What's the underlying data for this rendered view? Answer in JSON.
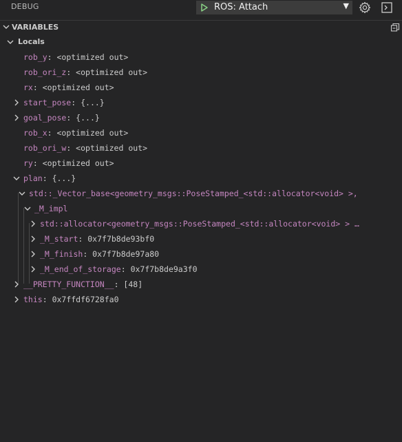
{
  "header": {
    "title": "DEBUG",
    "launch_config": "ROS: Attach"
  },
  "section": {
    "title": "VARIABLES"
  },
  "scope": {
    "label": "Locals"
  },
  "variables": [
    {
      "name": "rob_y",
      "value": "<optimized out>"
    },
    {
      "name": "rob_ori_z",
      "value": "<optimized out>"
    },
    {
      "name": "rx",
      "value": "<optimized out>"
    },
    {
      "name": "start_pose",
      "value": "{...}"
    },
    {
      "name": "goal_pose",
      "value": "{...}"
    },
    {
      "name": "rob_x",
      "value": "<optimized out>"
    },
    {
      "name": "rob_ori_w",
      "value": "<optimized out>"
    },
    {
      "name": "ry",
      "value": "<optimized out>"
    },
    {
      "name": "plan",
      "value": "{...}"
    },
    {
      "name": "std::_Vector_base<geometry_msgs::PoseStamped_<std::allocator<void> >,",
      "value": ""
    },
    {
      "name": "_M_impl",
      "value": ""
    },
    {
      "name": "std::allocator<geometry_msgs::PoseStamped_<std::allocator<void> > …",
      "value": ""
    },
    {
      "name": "_M_start",
      "value": "0x7f7b8de93bf0"
    },
    {
      "name": "_M_finish",
      "value": "0x7f7b8de97a80"
    },
    {
      "name": "_M_end_of_storage",
      "value": "0x7f7b8de9a3f0"
    },
    {
      "name": "__PRETTY_FUNCTION__",
      "value": "[48]"
    },
    {
      "name": "this",
      "value": "0x7ffdf6728fa0"
    }
  ],
  "colors": {
    "background": "#252526",
    "variable_name": "#c586c0",
    "value_text": "#cccccc",
    "play": "#89d185"
  },
  "icons": [
    "play-icon",
    "gear-icon",
    "console-icon",
    "chevron-down-icon",
    "chevron-right-icon",
    "collapse-all-icon"
  ]
}
